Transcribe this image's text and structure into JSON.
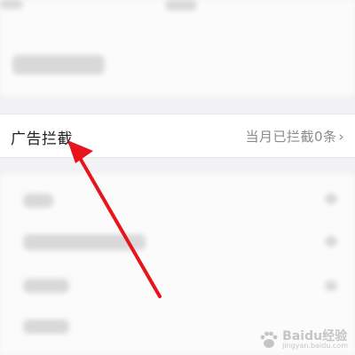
{
  "ad_block_row": {
    "title": "广告拦截",
    "status": "当月已拦截0条",
    "chevron": "›"
  },
  "annotation": {
    "arrow_color": "#e8141c"
  },
  "watermark": {
    "brand": "Baidu经验",
    "url": "jingyan.baidu.com",
    "icon": "paw-icon"
  }
}
